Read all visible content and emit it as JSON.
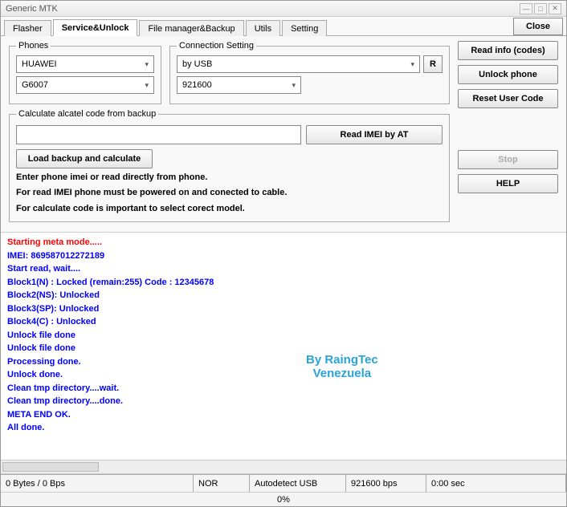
{
  "window": {
    "title": "Generic MTK"
  },
  "tabs": {
    "flasher": "Flasher",
    "service": "Service&Unlock",
    "filemgr": "File manager&Backup",
    "utils": "Utils",
    "setting": "Setting"
  },
  "close_btn": "Close",
  "phones": {
    "legend": "Phones",
    "brand": "HUAWEI",
    "model": "G6007"
  },
  "conn": {
    "legend": "Connection Setting",
    "mode": "by USB",
    "r_btn": "R",
    "baud": "921600"
  },
  "calc": {
    "legend": "Calculate alcatel code from backup",
    "input_value": "",
    "read_btn": "Read IMEI by AT",
    "load_btn": "Load backup and calculate",
    "instr1": "Enter phone imei or read directly from phone.",
    "instr2": "For read IMEI phone must be powered on and conected to cable.",
    "instr3": "For calculate code is important to select corect model."
  },
  "right": {
    "read_info": "Read info (codes)",
    "unlock": "Unlock phone",
    "reset": "Reset User Code",
    "stop": "Stop",
    "help": "HELP"
  },
  "log": [
    {
      "text": "Starting meta mode.....",
      "cls": "red"
    },
    {
      "text": "IMEI: 869587012272189",
      "cls": ""
    },
    {
      "text": "Start read, wait....",
      "cls": ""
    },
    {
      "text": "Block1(N)  : Locked (remain:255) Code : 12345678",
      "cls": ""
    },
    {
      "text": "Block2(NS): Unlocked",
      "cls": ""
    },
    {
      "text": "Block3(SP): Unlocked",
      "cls": ""
    },
    {
      "text": "Block4(C)  : Unlocked",
      "cls": ""
    },
    {
      "text": "Unlock file done",
      "cls": ""
    },
    {
      "text": "Unlock file done",
      "cls": ""
    },
    {
      "text": "Processing done.",
      "cls": ""
    },
    {
      "text": "Unlock done.",
      "cls": ""
    },
    {
      "text": "Clean tmp directory....wait.",
      "cls": ""
    },
    {
      "text": "Clean tmp directory....done.",
      "cls": ""
    },
    {
      "text": "META END OK.",
      "cls": ""
    },
    {
      "text": "All done.",
      "cls": ""
    }
  ],
  "watermark": {
    "line1": "By RaingTec",
    "line2": "Venezuela"
  },
  "status": {
    "bytes": "0 Bytes / 0 Bps",
    "nor": "NOR",
    "usb": "Autodetect USB",
    "bps": "921600 bps",
    "time": "0:00 sec"
  },
  "progress": "0%"
}
